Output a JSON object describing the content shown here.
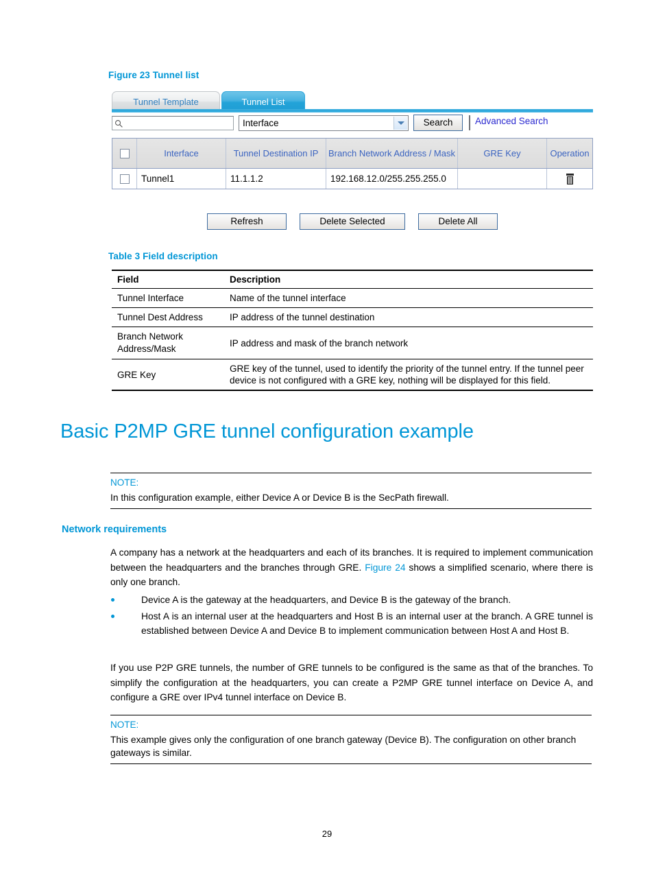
{
  "figure": {
    "caption": "Figure 23 Tunnel list",
    "tabs": [
      {
        "label": "Tunnel Template",
        "active": false
      },
      {
        "label": "Tunnel List",
        "active": true
      }
    ],
    "search": {
      "input_value": "",
      "placeholder": "",
      "select_value": "Interface",
      "search_button": "Search",
      "advanced_search": "Advanced Search",
      "search_icon": "magnifier-icon",
      "dropdown_icon": "chevron-down-icon"
    },
    "grid": {
      "headers": [
        "",
        "Interface",
        "Tunnel Destination IP",
        "Branch Network Address / Mask",
        "GRE Key",
        "Operation"
      ],
      "rows": [
        {
          "interface": "Tunnel1",
          "destination_ip": "11.1.1.2",
          "branch_network": "192.168.12.0/255.255.255.0",
          "gre_key": "",
          "operation_icon": "trash-icon"
        }
      ]
    },
    "buttons": {
      "refresh": "Refresh",
      "delete_selected": "Delete Selected",
      "delete_all": "Delete All"
    }
  },
  "table": {
    "caption": "Table 3 Field description",
    "headers": [
      "Field",
      "Description"
    ],
    "rows": [
      {
        "field": "Tunnel Interface",
        "description": "Name of the tunnel interface"
      },
      {
        "field": "Tunnel Dest Address",
        "description": "IP address of the tunnel destination"
      },
      {
        "field": "Branch Network Address/Mask",
        "description": "IP address and mask of the branch network"
      },
      {
        "field": "GRE Key",
        "description": "GRE key of the tunnel, used to identify the priority of the tunnel entry. If the tunnel peer device is not configured with a GRE key, nothing will be displayed for this field."
      }
    ]
  },
  "section": {
    "title": "Basic P2MP GRE tunnel configuration example"
  },
  "note1": {
    "label": "NOTE:",
    "text": "In this configuration example, either Device A or Device B is the SecPath firewall."
  },
  "subsection": {
    "title": "Network requirements"
  },
  "paragraphs": {
    "intro_part1": "A company has a network at the headquarters and each of its branches. It is required to implement communication between the headquarters and the branches through GRE. ",
    "intro_link": "Figure 24",
    "intro_part2": " shows a simplified scenario, where there is only one branch.",
    "bullets": [
      "Device A is the gateway at the headquarters, and Device B is the gateway of the branch.",
      "Host A is an internal user at the headquarters and Host B is an internal user at the branch. A GRE tunnel is established between Device A and Device B to implement communication between Host A and Host B."
    ],
    "closing": "If you use P2P GRE tunnels, the number of GRE tunnels to be configured is the same as that of the branches. To simplify the configuration at the headquarters, you can create a P2MP GRE tunnel interface on Device A, and configure a GRE over IPv4 tunnel interface on Device B."
  },
  "note2": {
    "label": "NOTE:",
    "text": "This example gives only the configuration of one branch gateway (Device B). The configuration on other branch gateways is similar."
  },
  "footer": {
    "page_number": "29"
  },
  "colors": {
    "brand_blue": "#0096d6",
    "link_blue": "#2b2ad0",
    "grid_header_text": "#3a63c0"
  }
}
